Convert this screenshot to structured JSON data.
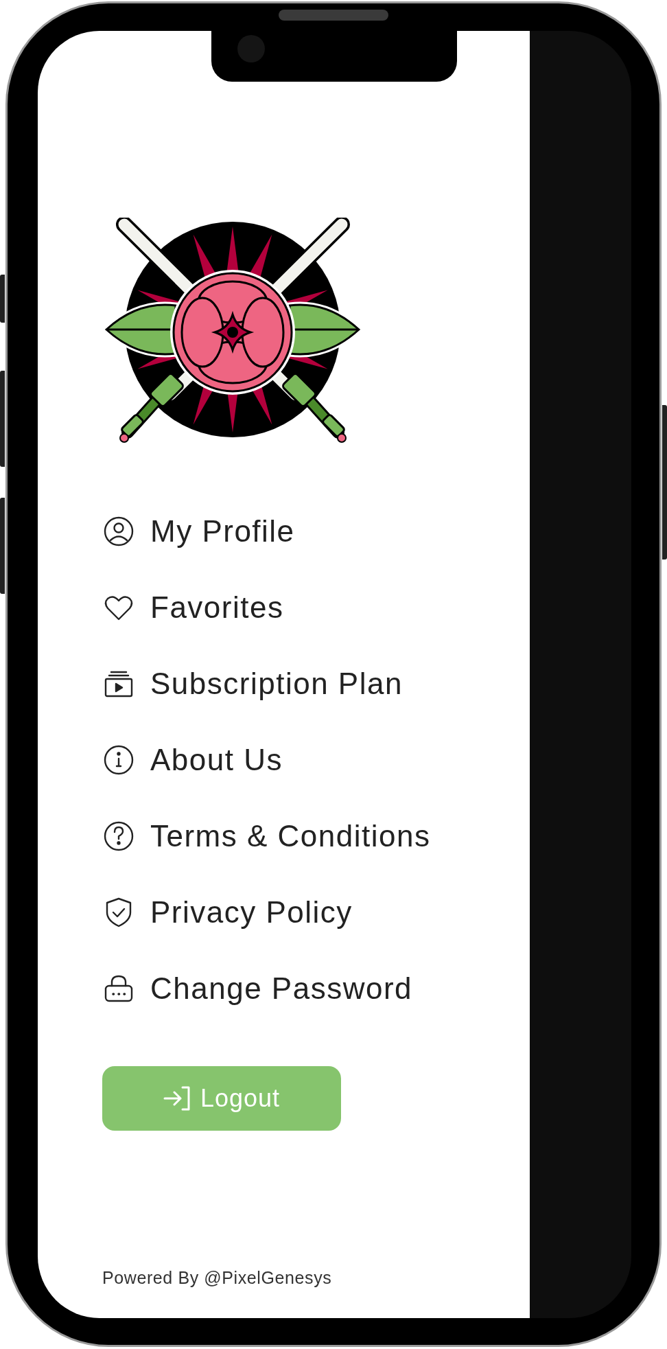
{
  "menu": [
    {
      "label": "My Profile"
    },
    {
      "label": "Favorites"
    },
    {
      "label": "Subscription Plan"
    },
    {
      "label": "About Us"
    },
    {
      "label": "Terms & Conditions"
    },
    {
      "label": "Privacy Policy"
    },
    {
      "label": "Change Password"
    }
  ],
  "logout_button": {
    "label": "Logout"
  },
  "footer": "Powered By @PixelGenesys"
}
